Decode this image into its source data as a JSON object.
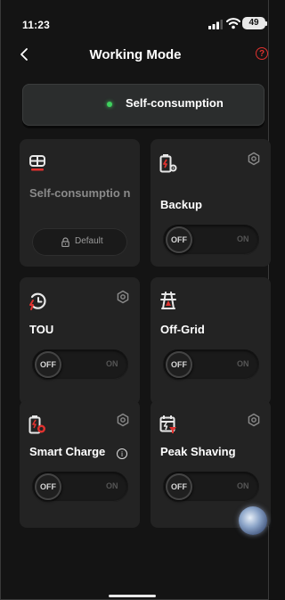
{
  "status_bar": {
    "time": "11:23",
    "battery": "49"
  },
  "header": {
    "title": "Working Mode",
    "help_symbol": "?"
  },
  "current_mode": {
    "label": "Self-consumption",
    "indicator_color": "#3fd15e"
  },
  "modes": [
    {
      "name": "Self-consumptio n",
      "icon": "self-consumption-icon",
      "action_label": "Default",
      "state": "default"
    },
    {
      "name": "Backup",
      "icon": "battery-gear-icon",
      "toggle_off": "OFF",
      "toggle_on": "ON",
      "state": "off"
    },
    {
      "name": "TOU",
      "icon": "clock-bolt-icon",
      "toggle_off": "OFF",
      "toggle_on": "ON",
      "state": "off"
    },
    {
      "name": "Off-Grid",
      "icon": "tower-icon",
      "toggle_off": "OFF",
      "toggle_on": "ON",
      "state": "off"
    },
    {
      "name": "Smart Charge",
      "icon": "battery-clock-icon",
      "info_symbol": "i",
      "toggle_off": "OFF",
      "toggle_on": "ON",
      "state": "off"
    },
    {
      "name": "Peak Shaving",
      "icon": "calendar-bolt-icon",
      "toggle_off": "OFF",
      "toggle_on": "ON",
      "state": "off"
    }
  ],
  "colors": {
    "accent_red": "#e0322f",
    "background": "#141414",
    "card": "#232323"
  }
}
